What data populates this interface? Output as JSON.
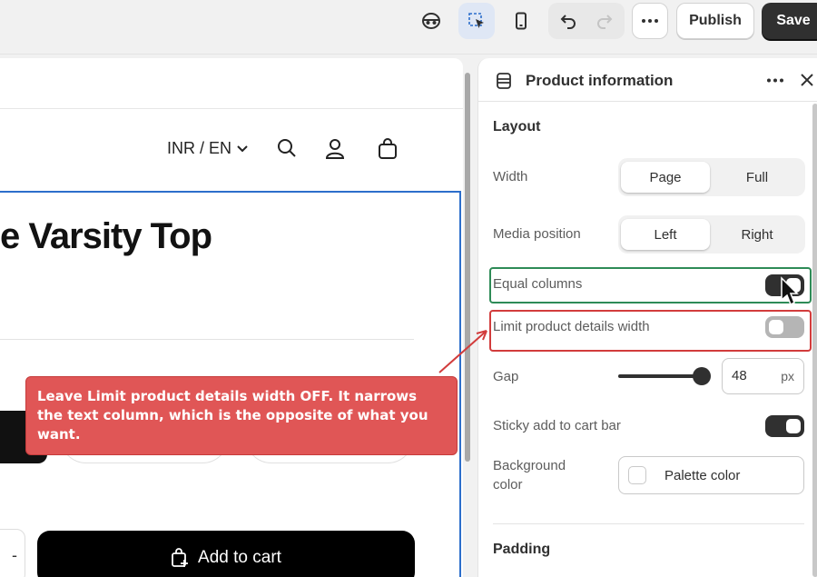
{
  "topbar": {
    "publish_label": "Publish",
    "save_label": "Save",
    "icons": [
      "preview-icon",
      "select-icon",
      "mobile-icon",
      "undo-icon",
      "redo-icon",
      "more-icon"
    ]
  },
  "storefront": {
    "currency_label": "INR / EN",
    "product_title": "e Varsity Top",
    "add_to_cart_label": "Add to cart",
    "quantity_minus": "-"
  },
  "panel": {
    "title": "Product information",
    "layout_heading": "Layout",
    "width": {
      "label": "Width",
      "options": [
        "Page",
        "Full"
      ],
      "selected": "Page"
    },
    "media_position": {
      "label": "Media position",
      "options": [
        "Left",
        "Right"
      ],
      "selected": "Left"
    },
    "equal_columns": {
      "label": "Equal columns",
      "on": true
    },
    "limit_width": {
      "label": "Limit product details width",
      "on": false
    },
    "gap": {
      "label": "Gap",
      "value": "48",
      "unit": "px"
    },
    "sticky": {
      "label": "Sticky add to cart bar",
      "on": true
    },
    "background": {
      "label": "Background color",
      "value": "Palette color"
    },
    "padding_heading": "Padding"
  },
  "annotation": {
    "text": "Leave Limit product details width OFF. It narrows the text column, which is the opposite of what you want."
  }
}
